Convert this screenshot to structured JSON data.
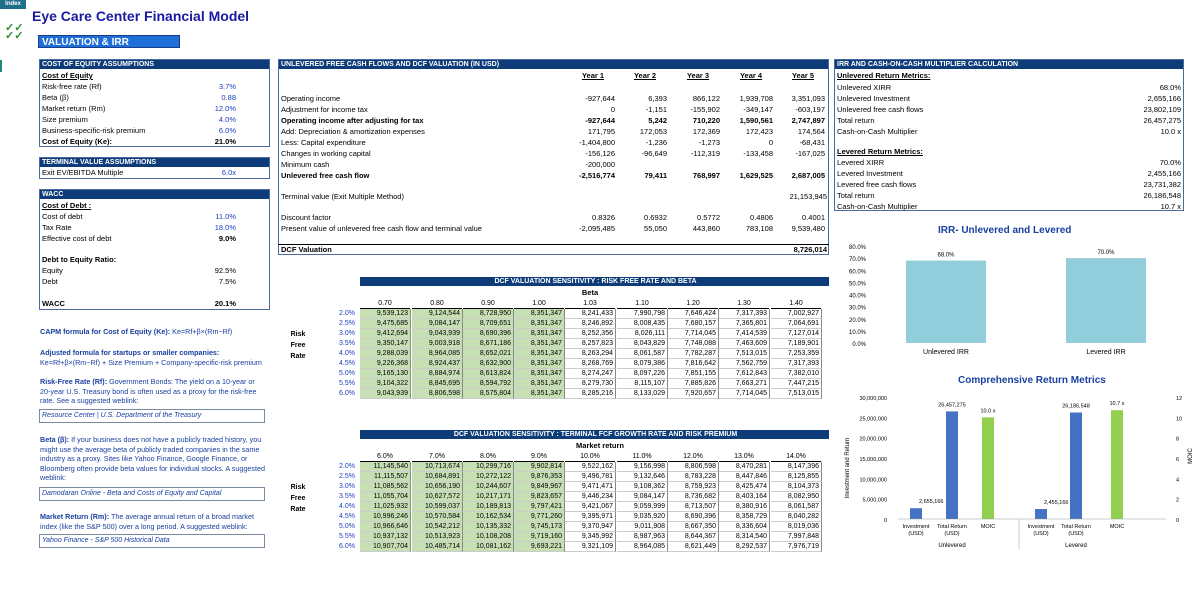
{
  "tab": "Index",
  "title": "Eye Care Center Financial Model",
  "checkmarks": "✓✓\n✓✓",
  "section_title": "VALUATION & IRR",
  "coe": {
    "header": "COST OF EQUITY ASSUMPTIONS",
    "sub": "Cost of Equity",
    "rows": [
      [
        "Risk-free rate (Rf)",
        "3.7%"
      ],
      [
        "Beta (β)",
        "0.88"
      ],
      [
        "Market return (Rm)",
        "12.0%"
      ],
      [
        "Size premium",
        "4.0%"
      ],
      [
        "Business-specific-risk premium",
        "6.0%"
      ]
    ],
    "total_label": "Cost of Equity (Ke):",
    "total_value": "21.0%"
  },
  "tv": {
    "header": "TERMINAL VALUE ASSUMPTIONS",
    "label": "Exit EV/EBITDA Multiple",
    "value": "6.0x"
  },
  "wacc": {
    "header": "WACC",
    "debt_title": "Cost of Debt :",
    "debt_rows": [
      [
        "Cost of debt",
        "11.0%"
      ],
      [
        "Tax Rate",
        "18.0%"
      ],
      [
        "Effective cost of debt",
        "9.0%"
      ]
    ],
    "ratio_title": "Debt to Equity Ratio:",
    "ratio_rows": [
      [
        "Equity",
        "92.5%"
      ],
      [
        "Debt",
        "7.5%"
      ]
    ],
    "wacc_label": "WACC",
    "wacc_value": "20.1%"
  },
  "notes": {
    "capm_label": "CAPM formula for Cost of Equity (Ke):",
    "capm_formula": " Ke=Rf+β×(Rm−Rf)",
    "adj_label": "Adjusted formula for startups or smaller companies:",
    "adj_formula": "Ke=Rf+β×(Rm−Rf) + Size Premium + Company-specific-risk premium",
    "rf_label": "Risk-Free Rate (Rf):",
    "rf_text": " Government Bonds: The yield on a 10-year or 20-year U.S. Treasury bond is often used as a proxy for the risk-free rate. See a suggested weblink:",
    "rf_link": "Resource Center | U.S. Department of the Treasury",
    "beta_label": "Beta (β):",
    "beta_text": " If your business does not have a publicly traded history, you might use the average beta of publicly traded companies in the same industry as a proxy. Sites like Yahoo Finance, Google Finance, or Bloomberg often provide beta values for individual stocks. A suggested weblink:",
    "beta_link": "Damodaran Online - Beta and Costs of Equity and Capital",
    "mr_label": "Market Return (Rm):",
    "mr_text": " The average annual return of a broad market index (like the S&P 500) over a long period. A suggested weblink:",
    "mr_link": "Yahoo Finance - S&P 500 Historical Data"
  },
  "dcf": {
    "header": "UNLEVERED FREE CASH FLOWS AND DCF VALUATION (IN USD)",
    "years": [
      "Year 1",
      "Year 2",
      "Year 3",
      "Year 4",
      "Year 5"
    ],
    "rows": [
      {
        "label": "Operating income",
        "bold": false,
        "vals": [
          "-927,644",
          "6,393",
          "866,122",
          "1,939,708",
          "3,351,093"
        ]
      },
      {
        "label": "Adjustment for income tax",
        "bold": false,
        "vals": [
          "0",
          "-1,151",
          "-155,902",
          "-349,147",
          "-603,197"
        ]
      },
      {
        "label": "Operating income after adjusting for tax",
        "bold": true,
        "vals": [
          "-927,644",
          "5,242",
          "710,220",
          "1,590,561",
          "2,747,897"
        ]
      },
      {
        "label": "Add: Depreciation & amortization expenses",
        "bold": false,
        "vals": [
          "171,795",
          "172,053",
          "172,369",
          "172,423",
          "174,564"
        ]
      },
      {
        "label": "Less: Capital expenditure",
        "bold": false,
        "vals": [
          "-1,404,800",
          "-1,236",
          "-1,273",
          "0",
          "-68,431"
        ]
      },
      {
        "label": "Changes in working capital",
        "bold": false,
        "vals": [
          "-156,126",
          "-96,649",
          "-112,319",
          "-133,458",
          "-167,025"
        ]
      },
      {
        "label": "Minimum cash",
        "bold": false,
        "vals": [
          "-200,000",
          "",
          "",
          "",
          ""
        ]
      },
      {
        "label": "Unlevered free cash flow",
        "bold": true,
        "vals": [
          "-2,516,774",
          "79,411",
          "768,997",
          "1,629,525",
          "2,687,005"
        ]
      }
    ],
    "tv_label": "Terminal value (Exit Multiple Method)",
    "tv_value": "21,153,945",
    "df_label": "Discount factor",
    "df_vals": [
      "0.8326",
      "0.6932",
      "0.5772",
      "0.4806",
      "0.4001"
    ],
    "pv_label": "Present value of unlevered free cash flow and terminal value",
    "pv_vals": [
      "-2,095,485",
      "55,050",
      "443,860",
      "783,108",
      "9,539,480"
    ],
    "val_label": "DCF Valuation",
    "val_value": "8,726,014"
  },
  "sens1": {
    "header": "DCF VALUATION SENSITIVITY : RISK FREE RATE AND BETA",
    "col_title": "Beta",
    "side": [
      "Risk",
      "Free",
      "Rate"
    ],
    "cols": [
      "0.70",
      "0.80",
      "0.90",
      "1.00",
      "1.03",
      "1.10",
      "1.20",
      "1.30",
      "1.40"
    ],
    "rows": [
      [
        "2.0%",
        "9,539,123",
        "9,124,544",
        "8,728,950",
        "8,351,347",
        "8,241,433",
        "7,990,798",
        "7,646,424",
        "7,317,393",
        "7,002,927"
      ],
      [
        "2.5%",
        "9,475,685",
        "9,084,147",
        "8,709,651",
        "8,351,347",
        "8,246,892",
        "8,008,435",
        "7,680,157",
        "7,365,801",
        "7,064,691"
      ],
      [
        "3.0%",
        "9,412,694",
        "9,043,939",
        "8,690,396",
        "8,351,347",
        "8,252,356",
        "8,026,111",
        "7,714,045",
        "7,414,539",
        "7,127,014"
      ],
      [
        "3.5%",
        "9,350,147",
        "9,003,918",
        "8,671,186",
        "8,351,347",
        "8,257,823",
        "8,043,829",
        "7,748,088",
        "7,463,609",
        "7,189,901"
      ],
      [
        "4.0%",
        "9,288,039",
        "8,964,085",
        "8,652,021",
        "8,351,347",
        "8,263,294",
        "8,061,587",
        "7,782,287",
        "7,513,015",
        "7,253,359"
      ],
      [
        "4.5%",
        "9,226,368",
        "8,924,437",
        "8,632,900",
        "8,351,347",
        "8,268,769",
        "8,079,386",
        "7,816,642",
        "7,562,759",
        "7,317,393"
      ],
      [
        "5.0%",
        "9,165,130",
        "8,884,974",
        "8,613,824",
        "8,351,347",
        "8,274,247",
        "8,097,226",
        "7,851,155",
        "7,612,843",
        "7,382,010"
      ],
      [
        "5.5%",
        "9,104,322",
        "8,845,695",
        "8,594,792",
        "8,351,347",
        "8,279,730",
        "8,115,107",
        "7,885,826",
        "7,663,271",
        "7,447,215"
      ],
      [
        "6.0%",
        "9,043,939",
        "8,806,598",
        "8,575,804",
        "8,351,347",
        "8,285,216",
        "8,133,029",
        "7,920,657",
        "7,714,045",
        "7,513,015"
      ]
    ]
  },
  "sens2": {
    "header": "DCF VALUATION SENSITIVITY : TERMINAL FCF GROWTH RATE AND RISK PREMIUM",
    "col_title": "Market return",
    "side": [
      "Risk",
      "Free",
      "Rate"
    ],
    "cols": [
      "6.0%",
      "7.0%",
      "8.0%",
      "9.0%",
      "10.0%",
      "11.0%",
      "12.0%",
      "13.0%",
      "14.0%"
    ],
    "rows": [
      [
        "2.0%",
        "11,145,540",
        "10,713,674",
        "10,299,716",
        "9,902,814",
        "9,522,162",
        "9,156,998",
        "8,806,598",
        "8,470,281",
        "8,147,396"
      ],
      [
        "2.5%",
        "11,115,507",
        "10,684,891",
        "10,272,122",
        "9,876,353",
        "9,496,781",
        "9,132,646",
        "8,783,228",
        "8,447,846",
        "8,125,855"
      ],
      [
        "3.0%",
        "11,085,562",
        "10,656,190",
        "10,244,607",
        "9,849,967",
        "9,471,471",
        "9,108,362",
        "8,759,923",
        "8,425,474",
        "8,104,373"
      ],
      [
        "3.5%",
        "11,055,704",
        "10,627,572",
        "10,217,171",
        "9,823,657",
        "9,446,234",
        "9,084,147",
        "8,736,682",
        "8,403,164",
        "8,082,950"
      ],
      [
        "4.0%",
        "11,025,932",
        "10,599,037",
        "10,189,813",
        "9,797,421",
        "9,421,067",
        "9,059,999",
        "8,713,507",
        "8,380,916",
        "8,061,587"
      ],
      [
        "4.5%",
        "10,996,246",
        "10,570,584",
        "10,162,534",
        "9,771,260",
        "9,395,971",
        "9,035,920",
        "8,690,396",
        "8,358,729",
        "8,040,282"
      ],
      [
        "5.0%",
        "10,966,646",
        "10,542,212",
        "10,135,332",
        "9,745,173",
        "9,370,947",
        "9,011,908",
        "8,667,350",
        "8,336,604",
        "8,019,036"
      ],
      [
        "5.5%",
        "10,937,132",
        "10,513,923",
        "10,108,208",
        "9,719,160",
        "9,345,992",
        "8,987,963",
        "8,644,367",
        "8,314,540",
        "7,997,848"
      ],
      [
        "6.0%",
        "10,907,704",
        "10,485,714",
        "10,081,162",
        "9,693,221",
        "9,321,109",
        "8,964,085",
        "8,621,449",
        "8,292,537",
        "7,976,719"
      ]
    ]
  },
  "irr": {
    "header": "IRR AND CASH-ON-CASH MULTIPLIER CALCULATION",
    "unlev_title": "Unlevered Return Metrics:",
    "unlev": [
      [
        "Unlevered  XIRR",
        "68.0%"
      ],
      [
        "Unlevered  Investment",
        "2,655,166"
      ],
      [
        "Unlevered free cash flows",
        "23,802,109"
      ],
      [
        "Total return",
        "26,457,275"
      ],
      [
        "Cash-on-Cash Multiplier",
        "10.0 x"
      ]
    ],
    "lev_title": "Levered Return Metrics:",
    "lev": [
      [
        "Levered  XIRR",
        "70.0%"
      ],
      [
        "Levered  Investment",
        "2,455,166"
      ],
      [
        "Levered free cash flows",
        "23,731,382"
      ],
      [
        "Total return",
        "26,186,548"
      ],
      [
        "Cash-on-Cash Multiplier",
        "10.7 x"
      ]
    ]
  },
  "chart_data": [
    {
      "type": "bar",
      "title": "IRR- Unlevered and Levered",
      "categories": [
        "Unlevered IRR",
        "Levered IRR"
      ],
      "values": [
        0.68,
        0.7
      ],
      "data_labels": [
        "68.0%",
        "70.0%"
      ],
      "y_ticks": [
        "0.0%",
        "10.0%",
        "20.0%",
        "30.0%",
        "40.0%",
        "50.0%",
        "60.0%",
        "70.0%",
        "80.0%"
      ],
      "ylim": [
        0,
        0.8
      ],
      "color": "#92cddc"
    },
    {
      "type": "bar",
      "title": "Comprehensive Return Metrics",
      "ylabel": "Investment and Return",
      "y2label": "MOIC",
      "groups": [
        "Unlevered",
        "Levered"
      ],
      "categories": [
        "Investment (USD)",
        "Total Return (USD)",
        "MOIC"
      ],
      "series": [
        {
          "group": "Unlevered",
          "values": [
            2655166,
            26457275,
            10.0
          ],
          "labels": [
            "2,655,166",
            "26,457,275",
            "10.0 x"
          ]
        },
        {
          "group": "Levered",
          "values": [
            2455166,
            26186548,
            10.7
          ],
          "labels": [
            "2,455,166",
            "26,186,548",
            "10.7 x"
          ]
        }
      ],
      "y_ticks": [
        "0",
        "5,000,000",
        "10,000,000",
        "15,000,000",
        "20,000,000",
        "25,000,000",
        "30,000,000"
      ],
      "ylim": [
        0,
        30000000
      ],
      "y2_ticks": [
        "0",
        "2",
        "4",
        "6",
        "8",
        "10",
        "12"
      ],
      "y2lim": [
        0,
        12
      ],
      "colors": {
        "investment": "#4472c4",
        "return": "#4472c4",
        "moic": "#92d050"
      }
    }
  ]
}
